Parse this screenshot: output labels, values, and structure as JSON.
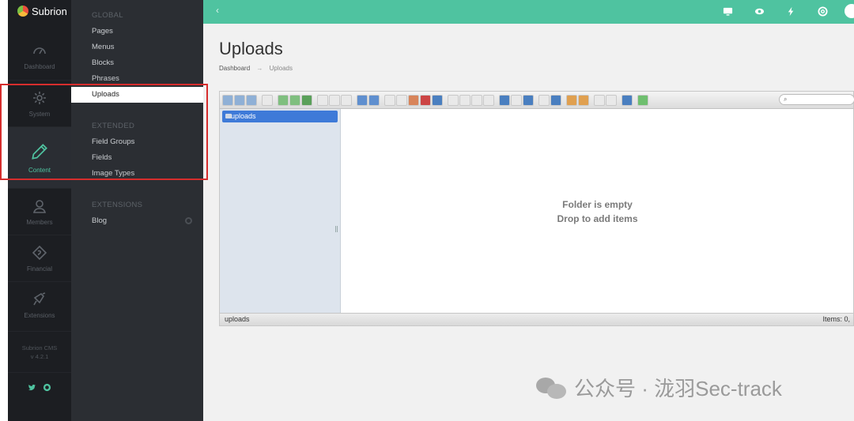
{
  "brand": {
    "name": "Subrion"
  },
  "rail": {
    "items": [
      {
        "label": "Dashboard",
        "icon": "speedometer-icon"
      },
      {
        "label": "System",
        "icon": "gear-icon"
      },
      {
        "label": "Content",
        "icon": "pencil-icon",
        "active": true
      },
      {
        "label": "Members",
        "icon": "user-icon"
      },
      {
        "label": "Financial",
        "icon": "money-icon"
      },
      {
        "label": "Extensions",
        "icon": "puzzle-icon"
      }
    ],
    "version_line1": "Subrion CMS",
    "version_line2": "v 4.2.1",
    "social_twitter": "🐦",
    "social_github": "⌬"
  },
  "submenu": {
    "global_heading": "GLOBAL",
    "global_items": [
      "Pages",
      "Menus",
      "Blocks",
      "Phrases",
      "Uploads"
    ],
    "extended_heading": "EXTENDED",
    "extended_items": [
      "Field Groups",
      "Fields",
      "Image Types"
    ],
    "extensions_heading": "EXTENSIONS",
    "extensions_items": [
      "Blog"
    ],
    "active_item": "Uploads"
  },
  "topbar": {
    "back_glyph": "‹",
    "icons": [
      "monitor-icon",
      "eye-icon",
      "bolt-icon",
      "lifebuoy-icon"
    ],
    "accent": "#4fc3a0"
  },
  "page": {
    "title": "Uploads",
    "breadcrumb_root": "Dashboard",
    "breadcrumb_arrow": "→",
    "breadcrumb_current": "Uploads"
  },
  "file_manager": {
    "search_glyph": "⌕",
    "tree_root": "uploads",
    "empty_line1": "Folder is empty",
    "empty_line2": "Drop to add items",
    "status_path": "uploads",
    "status_items": "Items: 0,"
  },
  "watermark": {
    "text": "公众号 · 泷羽Sec-track"
  }
}
